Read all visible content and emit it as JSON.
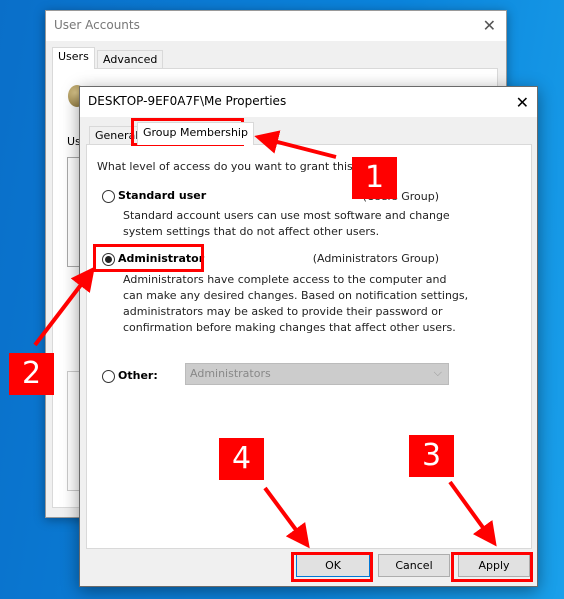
{
  "back_window": {
    "title": "User Accounts",
    "tabs": [
      {
        "label": "Users",
        "selected": true
      },
      {
        "label": "Advanced",
        "selected": false
      }
    ],
    "partial_label": "Us"
  },
  "dialog": {
    "title": "DESKTOP-9EF0A7F\\Me Properties",
    "tabs": [
      {
        "label": "General",
        "selected": false
      },
      {
        "label": "Group Membership",
        "selected": true
      }
    ],
    "question": "What level of access do you want to grant this user?",
    "options": [
      {
        "label": "Standard user",
        "group": "(Users Group)",
        "selected": false,
        "description": [
          "Standard account users can use most software and change",
          "system settings that do not affect other users."
        ]
      },
      {
        "label": "Administrator",
        "group": "(Administrators Group)",
        "selected": true,
        "description": [
          "Administrators have complete access to the computer and",
          "can make any desired changes. Based on notification settings,",
          "administrators may be asked to provide their password or",
          "confirmation before making changes that affect other users."
        ]
      },
      {
        "label": "Other:",
        "selected": false,
        "select_value": "Administrators"
      }
    ],
    "buttons": {
      "ok": "OK",
      "cancel": "Cancel",
      "apply": "Apply"
    }
  },
  "annotations": {
    "color": "#ff0000",
    "steps": [
      "1",
      "2",
      "3",
      "4"
    ]
  }
}
